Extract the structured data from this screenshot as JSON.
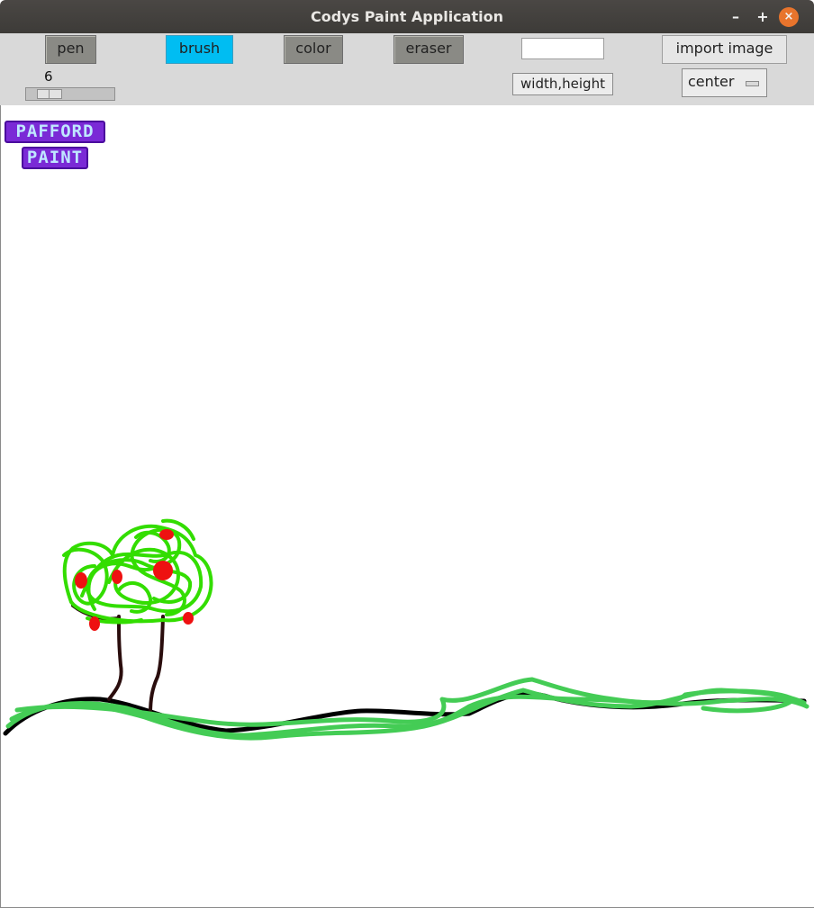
{
  "window": {
    "title": "Codys Paint Application"
  },
  "window_controls": {
    "minimize": "–",
    "maximize": "+",
    "close": "×"
  },
  "toolbar": {
    "pen": "pen",
    "brush": "brush",
    "color": "color",
    "eraser": "eraser",
    "size_entry_value": "",
    "import_image": "import image",
    "width_height": "width,height",
    "position_option": "center",
    "brush_size": "6",
    "active_tool": "brush"
  },
  "canvas": {
    "logo": {
      "line1": "PAFFORD",
      "line2": "PAINT"
    },
    "colors": {
      "background": "#ffffff",
      "trunk": "#2a0d0d",
      "foliage": "#33dd00",
      "fruit": "#ee1111",
      "grass": "#44cc55",
      "ground": "#000000"
    }
  },
  "theme": {
    "accent": "#00bdf2",
    "titlebar": "#403e3b",
    "close": "#e8742c",
    "toolbar": "#d9d9d9",
    "tool_button": "#8a8a85"
  }
}
